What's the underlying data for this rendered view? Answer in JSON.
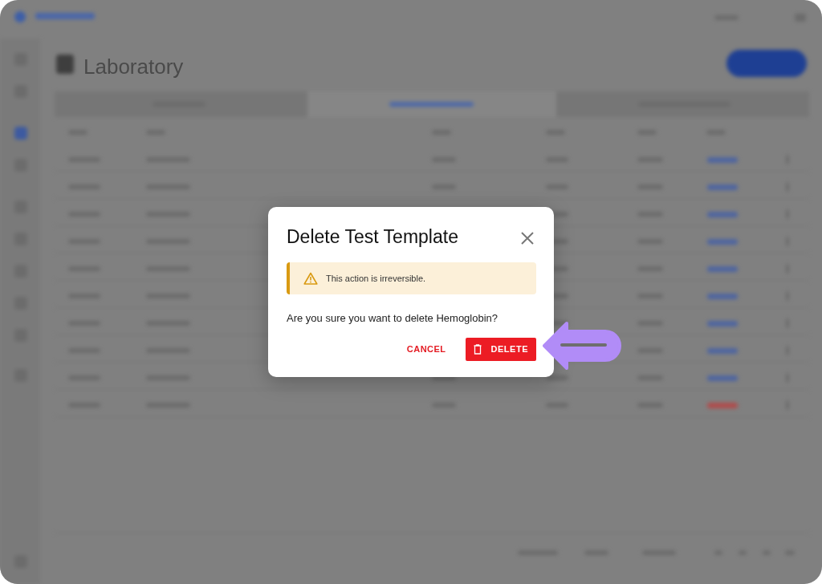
{
  "page": {
    "title": "Laboratory"
  },
  "dialog": {
    "title": "Delete Test Template",
    "alert": {
      "kind": "warning",
      "text": "This action is irreversible."
    },
    "message": "Are you sure you want to delete Hemoglobin?",
    "buttons": [
      {
        "label": "CANCEL",
        "kind": "text"
      },
      {
        "label": "DELETE",
        "kind": "danger"
      }
    ]
  }
}
